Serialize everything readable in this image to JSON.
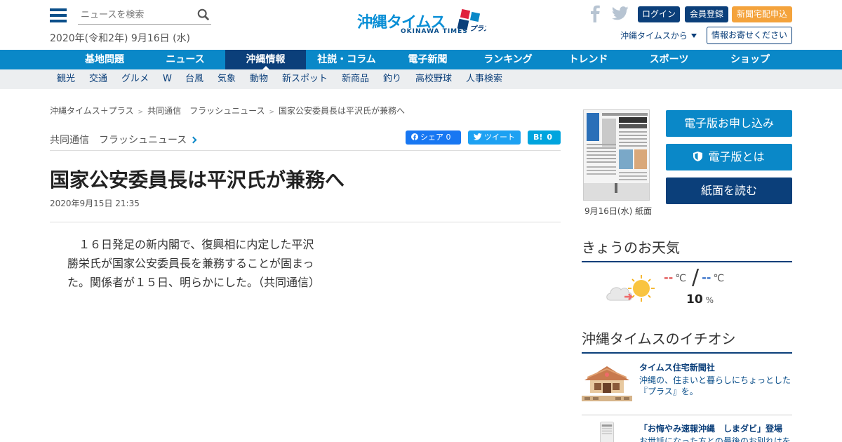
{
  "header": {
    "search_placeholder": "ニュースを検索",
    "date": "2020年(令和2年) 9月16日 (水)",
    "logo_text": "沖縄タイムス",
    "logo_sub": "OKINAWA TIMES",
    "login": "ログイン",
    "member": "会員登録",
    "delivery": "新聞宅配申込",
    "from_okinawa": "沖縄タイムスから",
    "info": "情報お寄せください"
  },
  "nav": {
    "main": [
      {
        "label": "基地問題"
      },
      {
        "label": "ニュース"
      },
      {
        "label": "沖縄情報"
      },
      {
        "label": "社説・コラム"
      },
      {
        "label": "電子新聞"
      },
      {
        "label": "ランキング"
      },
      {
        "label": "トレンド"
      },
      {
        "label": "スポーツ"
      },
      {
        "label": "ショップ"
      }
    ],
    "active_index": 2,
    "sub": [
      {
        "label": "観光"
      },
      {
        "label": "交通"
      },
      {
        "label": "グルメ"
      },
      {
        "label": "W"
      },
      {
        "label": "台風"
      },
      {
        "label": "気象"
      },
      {
        "label": "動物"
      },
      {
        "label": "新スポット"
      },
      {
        "label": "新商品"
      },
      {
        "label": "釣り"
      },
      {
        "label": "高校野球"
      },
      {
        "label": "人事検索"
      }
    ]
  },
  "breadcrumb": [
    "沖縄タイムス＋プラス",
    "共同通信　フラッシュニュース",
    "国家公安委員長は平沢氏が兼務へ"
  ],
  "article": {
    "category": "共同通信　フラッシュニュース",
    "share_fb": "シェア 0",
    "share_tw": "ツイート",
    "share_hb": "0",
    "title": "国家公安委員長は平沢氏が兼務へ",
    "date": "2020年9月15日 21:35",
    "body": "　１６日発足の新内閣で、復興相に内定した平沢勝栄氏が国家公安委員長を兼務することが固まった。関係者が１５日、明らかにした。（共同通信）"
  },
  "sidebar": {
    "paper_caption": "9月16日(水) 紙面",
    "btn_apply": "電子版お申し込み",
    "btn_about": "電子版とは",
    "btn_read": "紙面を読む",
    "weather_heading": "きょうのお天気",
    "temp_high": "--",
    "temp_low": "--",
    "temp_unit": "℃",
    "rain": "10",
    "rain_unit": "%",
    "pick_heading": "沖縄タイムスのイチオシ",
    "picks": [
      {
        "title": "タイムス住宅新聞社",
        "desc": "沖縄の、住まいと暮らしにちょっとした『プラス』を。"
      },
      {
        "title": "「お悔やみ速報沖縄　しまダビ」登場",
        "desc": "お世話になった方との最後のお別れはを"
      }
    ]
  },
  "colors": {
    "brand_blue": "#0a88c8",
    "brand_navy": "#0b3f7a",
    "delivery_orange": "#f4a33c"
  }
}
